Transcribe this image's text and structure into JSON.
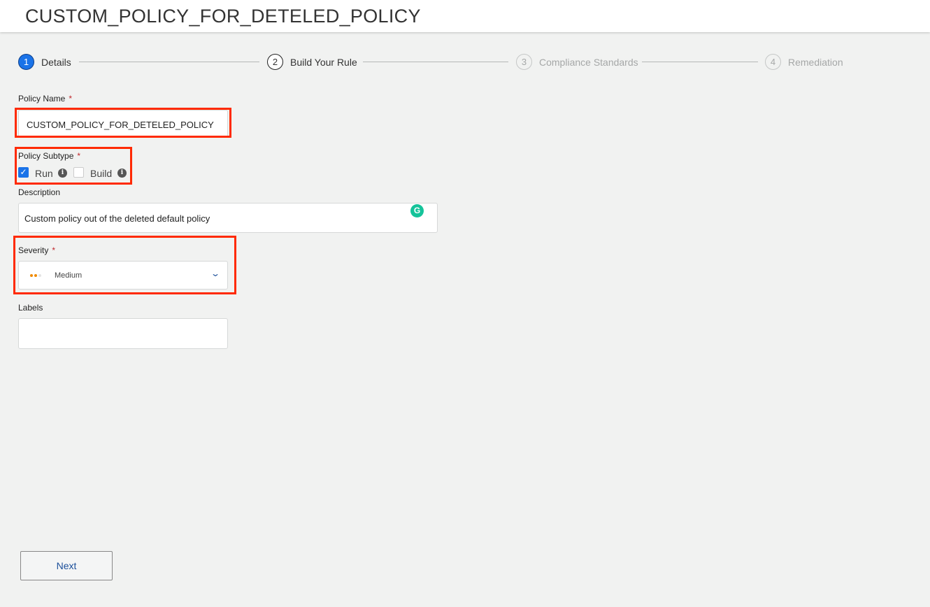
{
  "header": {
    "title": "CUSTOM_POLICY_FOR_DETELED_POLICY"
  },
  "steps": [
    {
      "number": "1",
      "label": "Details",
      "state": "active"
    },
    {
      "number": "2",
      "label": "Build Your Rule",
      "state": "enabled"
    },
    {
      "number": "3",
      "label": "Compliance Standards",
      "state": "disabled"
    },
    {
      "number": "4",
      "label": "Remediation",
      "state": "disabled"
    }
  ],
  "form": {
    "policy_name": {
      "label": "Policy Name",
      "required": "*",
      "value": "CUSTOM_POLICY_FOR_DETELED_POLICY"
    },
    "policy_subtype": {
      "label": "Policy Subtype",
      "required": "*",
      "options": [
        {
          "label": "Run",
          "checked": true
        },
        {
          "label": "Build",
          "checked": false
        }
      ]
    },
    "description": {
      "label": "Description",
      "value": "Custom policy out of the deleted default policy"
    },
    "severity": {
      "label": "Severity",
      "required": "*",
      "value": "Medium"
    },
    "labels": {
      "label": "Labels",
      "value": ""
    }
  },
  "buttons": {
    "next": "Next"
  },
  "colors": {
    "accent": "#1a73e8",
    "highlight": "#ff2a00",
    "severity_medium": "#f08a00",
    "grammarly": "#15c39a"
  }
}
